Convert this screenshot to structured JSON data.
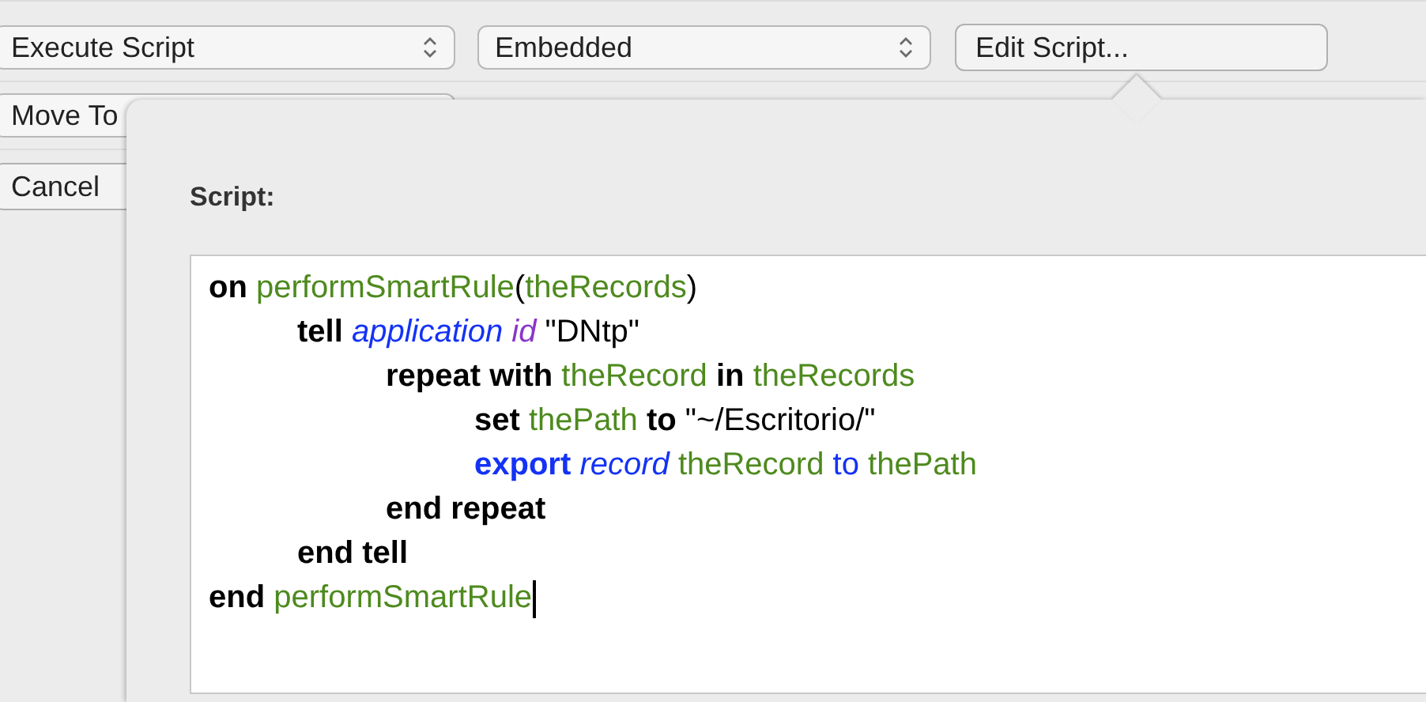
{
  "toolbar": {
    "action_popup": {
      "value": "Execute Script"
    },
    "source_popup": {
      "value": "Embedded"
    },
    "edit_button": {
      "label": "Edit Script..."
    }
  },
  "second_popup": {
    "value": "Move To"
  },
  "cancel_button": {
    "label": "Cancel"
  },
  "popover": {
    "label": "Script:",
    "code_lines": [
      {
        "tokens": [
          {
            "kind": "keyword",
            "text": "on "
          },
          {
            "kind": "variable",
            "text": "performSmartRule"
          },
          {
            "kind": "plain",
            "text": "("
          },
          {
            "kind": "variable",
            "text": "theRecords"
          },
          {
            "kind": "plain",
            "text": ")"
          }
        ],
        "children": [
          {
            "tokens": [
              {
                "kind": "keyword",
                "text": "tell "
              },
              {
                "kind": "class",
                "text": "application "
              },
              {
                "kind": "property",
                "text": "id "
              },
              {
                "kind": "plain",
                "text": "\"DNtp\""
              }
            ],
            "children": [
              {
                "tokens": [
                  {
                    "kind": "keyword",
                    "text": "repeat with "
                  },
                  {
                    "kind": "variable",
                    "text": "theRecord "
                  },
                  {
                    "kind": "keyword",
                    "text": "in "
                  },
                  {
                    "kind": "variable",
                    "text": "theRecords"
                  }
                ],
                "children": [
                  {
                    "tokens": [
                      {
                        "kind": "keyword",
                        "text": "set "
                      },
                      {
                        "kind": "variable",
                        "text": "thePath "
                      },
                      {
                        "kind": "keyword",
                        "text": "to "
                      },
                      {
                        "kind": "plain",
                        "text": "\"~/Escritorio/\""
                      }
                    ]
                  },
                  {
                    "tokens": [
                      {
                        "kind": "command",
                        "text": "export "
                      },
                      {
                        "kind": "class",
                        "text": "record "
                      },
                      {
                        "kind": "variable",
                        "text": "theRecord "
                      },
                      {
                        "kind": "operator",
                        "text": "to "
                      },
                      {
                        "kind": "variable",
                        "text": "thePath"
                      }
                    ]
                  }
                ]
              },
              {
                "tokens": [
                  {
                    "kind": "keyword",
                    "text": "end repeat"
                  }
                ]
              }
            ]
          },
          {
            "tokens": [
              {
                "kind": "keyword",
                "text": "end tell"
              }
            ]
          }
        ]
      },
      {
        "tokens": [
          {
            "kind": "keyword",
            "text": "end "
          },
          {
            "kind": "variable",
            "text": "performSmartRule"
          }
        ]
      }
    ]
  }
}
